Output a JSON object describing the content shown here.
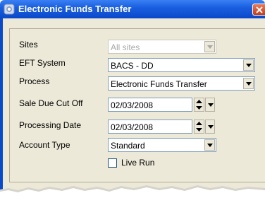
{
  "window": {
    "title": "Electronic Funds Transfer"
  },
  "icons": {
    "app": "app-icon",
    "close": "close-icon",
    "dropdown": "chevron-down-icon",
    "spin": "spin-updown-icon"
  },
  "fields": {
    "sites": {
      "label": "Sites",
      "value": "All sites"
    },
    "eft_system": {
      "label": "EFT System",
      "value": "BACS - DD"
    },
    "process": {
      "label": "Process",
      "value": "Electronic Funds Transfer"
    },
    "sale_due_cut_off": {
      "label": "Sale Due Cut Off",
      "value": "02/03/2008"
    },
    "processing_date": {
      "label": "Processing Date",
      "value": "02/03/2008"
    },
    "account_type": {
      "label": "Account Type",
      "value": "Standard"
    },
    "live_run": {
      "label": "Live Run",
      "checked": false
    }
  },
  "colors": {
    "titlebar": "#0a49c9",
    "close_button": "#c63c17",
    "dialog_bg": "#ece9d8",
    "input_border": "#7f9db9"
  }
}
